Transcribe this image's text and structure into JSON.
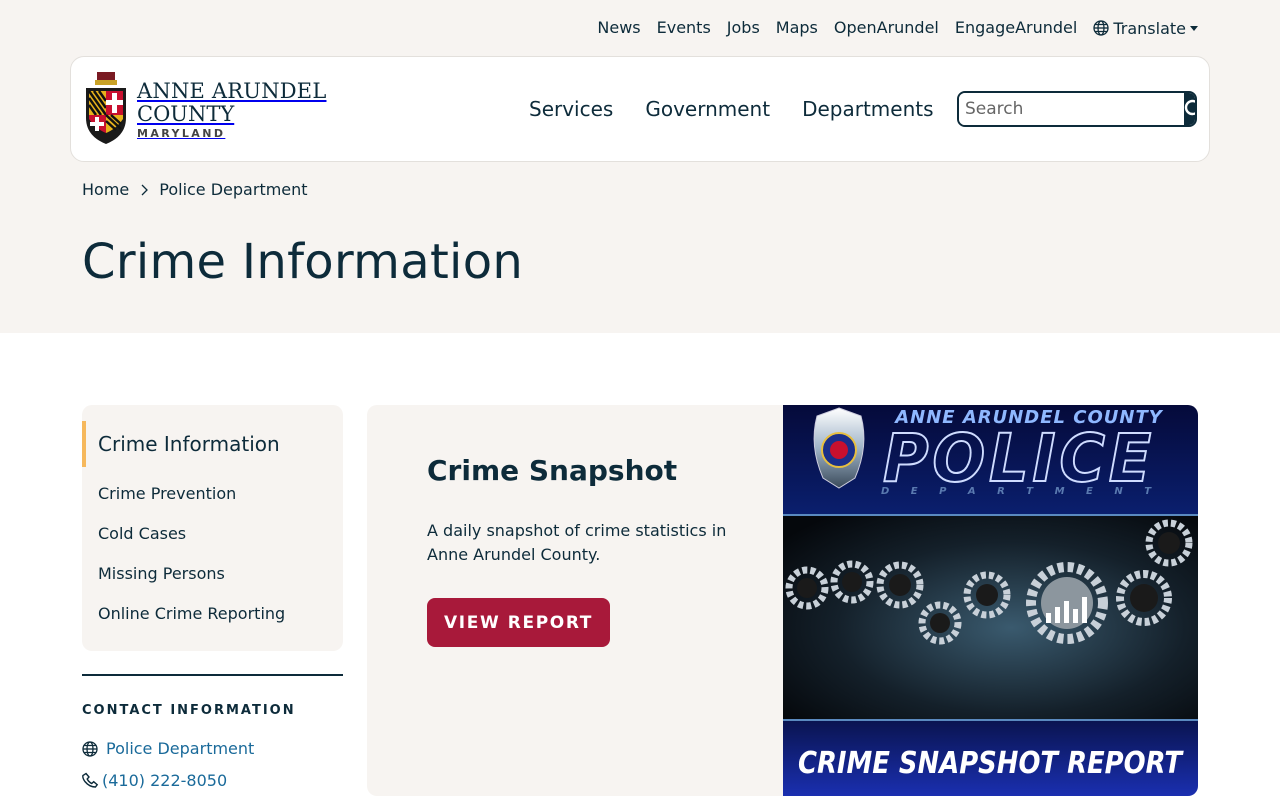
{
  "utility_nav": {
    "items": [
      "News",
      "Events",
      "Jobs",
      "Maps",
      "OpenArundel",
      "EngageArundel"
    ],
    "translate_label": "Translate"
  },
  "logo": {
    "line1": "ANNE ARUNDEL",
    "line2": "COUNTY",
    "line3": "MARYLAND"
  },
  "main_nav": {
    "items": [
      "Services",
      "Government",
      "Departments"
    ]
  },
  "search": {
    "placeholder": "Search"
  },
  "breadcrumb": {
    "home": "Home",
    "current": "Police Department"
  },
  "page_title": "Crime Information",
  "sidebar": {
    "current": "Crime Information",
    "items": [
      "Crime Prevention",
      "Cold Cases",
      "Missing Persons",
      "Online Crime Reporting"
    ]
  },
  "contact": {
    "heading": "CONTACT INFORMATION",
    "website_label": "Police Department",
    "phone": "(410) 222-8050"
  },
  "card": {
    "title": "Crime Snapshot",
    "description": "A daily snapshot of crime statistics in Anne Arundel County.",
    "button_label": "VIEW REPORT",
    "image": {
      "top_line": "ANNE ARUNDEL COUNTY",
      "big_word": "POLICE",
      "sub_word": "D E P A R T M E N T",
      "bottom_caption": "CRIME SNAPSHOT REPORT"
    }
  },
  "colors": {
    "navy": "#0d2b3a",
    "crimson": "#a8193a",
    "accent_gold": "#f6b85c",
    "link_blue": "#1a6a9a",
    "sand_bg": "#f7f4f1"
  }
}
